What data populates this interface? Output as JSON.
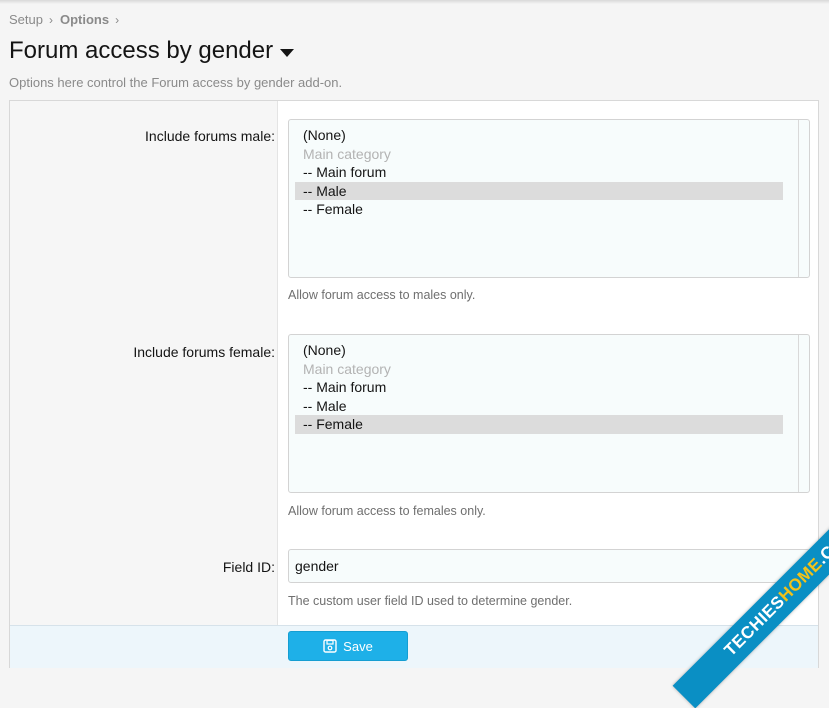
{
  "breadcrumb": {
    "items": [
      "Setup",
      "Options"
    ]
  },
  "page": {
    "title": "Forum access by gender",
    "description": "Options here control the Forum access by gender add-on."
  },
  "options": {
    "male": {
      "label": "Include forums male:",
      "items": [
        {
          "text": "(None)",
          "state": "normal"
        },
        {
          "text": "Main category",
          "state": "disabled"
        },
        {
          "text": "-- Main forum",
          "state": "normal"
        },
        {
          "text": "-- Male",
          "state": "selected"
        },
        {
          "text": "-- Female",
          "state": "normal"
        }
      ],
      "hint": "Allow forum access to males only."
    },
    "female": {
      "label": "Include forums female:",
      "items": [
        {
          "text": "(None)",
          "state": "normal"
        },
        {
          "text": "Main category",
          "state": "disabled"
        },
        {
          "text": "-- Main forum",
          "state": "normal"
        },
        {
          "text": "-- Male",
          "state": "normal"
        },
        {
          "text": "-- Female",
          "state": "selected"
        }
      ],
      "hint": "Allow forum access to females only."
    },
    "field_id": {
      "label": "Field ID:",
      "value": "gender",
      "hint": "The custom user field ID used to determine gender."
    }
  },
  "footer": {
    "save_label": "Save",
    "save_icon": "save-icon"
  },
  "watermark": {
    "part1": "TECHIES",
    "part2": "HOME",
    "part3": ".COM"
  },
  "colors": {
    "accent": "#1eb0e8",
    "selected_bg": "#dcdcdc",
    "watermark_bg": "#0a8fc4",
    "watermark_yellow": "#f2c21a"
  }
}
